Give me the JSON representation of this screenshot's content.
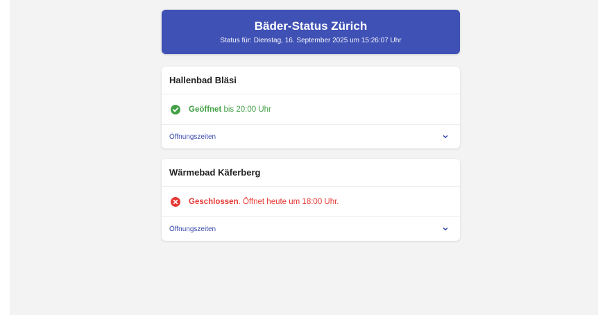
{
  "colors": {
    "header_bg": "#3f51b5",
    "open": "#43a047",
    "closed": "#e53935",
    "link": "#3949ab",
    "page_bg": "#f3f3f3"
  },
  "header": {
    "title": "Bäder-Status Zürich",
    "subtitle": "Status für: Dienstag, 16. September 2025 um 15:26:07 Uhr"
  },
  "pools": [
    {
      "name": "Hallenbad Bläsi",
      "status": "open",
      "status_icon": "check-circle-icon",
      "status_strong": "Geöffnet",
      "status_rest": " bis 20:00 Uhr",
      "hours_label": "Öffnungszeiten"
    },
    {
      "name": "Wärmebad Käferberg",
      "status": "closed",
      "status_icon": "x-circle-icon",
      "status_strong": "Geschlossen",
      "status_rest": ". Öffnet heute um 18:00 Uhr.",
      "hours_label": "Öffnungszeiten"
    }
  ]
}
